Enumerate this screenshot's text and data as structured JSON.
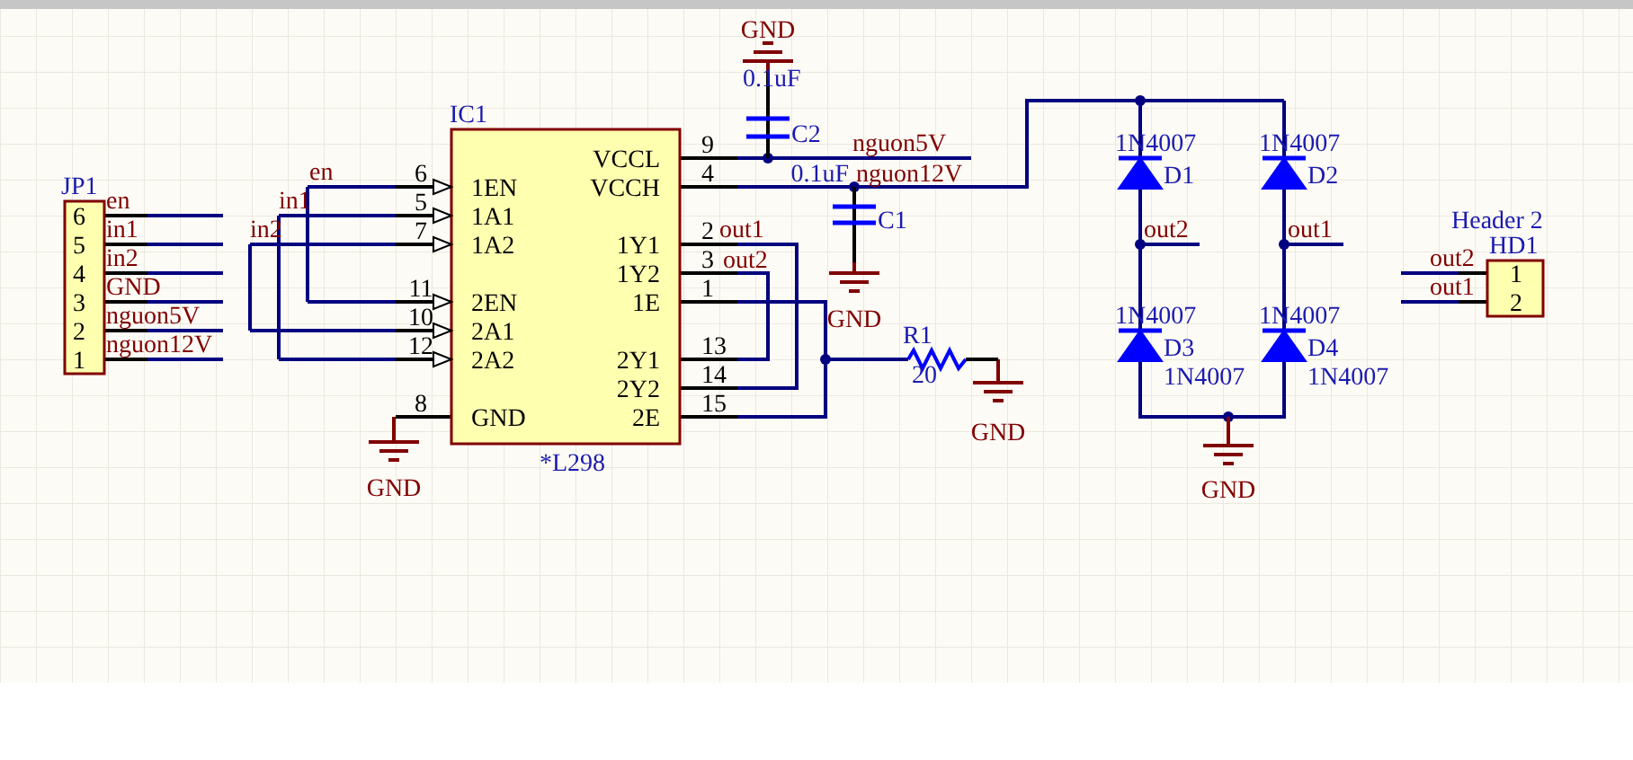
{
  "connectors": [
    {
      "designator": "JP1",
      "pins": [
        {
          "number": "6",
          "net": "en"
        },
        {
          "number": "5",
          "net": "in1"
        },
        {
          "number": "4",
          "net": "in2"
        },
        {
          "number": "3",
          "net": "GND"
        },
        {
          "number": "2",
          "net": "nguon5V"
        },
        {
          "number": "1",
          "net": "nguon12V"
        }
      ]
    },
    {
      "designator": "HD1",
      "comment": "Header 2",
      "pins": [
        {
          "number": "1",
          "net": "out2"
        },
        {
          "number": "2",
          "net": "out1"
        }
      ]
    }
  ],
  "ic": {
    "designator": "IC1",
    "comment": "*L298",
    "pins": [
      {
        "number": "6",
        "name": "1EN",
        "kind": "input"
      },
      {
        "number": "5",
        "name": "1A1",
        "kind": "input"
      },
      {
        "number": "7",
        "name": "1A2",
        "kind": "input"
      },
      {
        "number": "11",
        "name": "2EN",
        "kind": "input"
      },
      {
        "number": "10",
        "name": "2A1",
        "kind": "input"
      },
      {
        "number": "12",
        "name": "2A2",
        "kind": "input"
      },
      {
        "number": "8",
        "name": "GND",
        "kind": "passive"
      },
      {
        "number": "9",
        "name": "VCCL",
        "kind": "passive"
      },
      {
        "number": "4",
        "name": "VCCH",
        "kind": "passive"
      },
      {
        "number": "2",
        "name": "1Y1",
        "kind": "passive"
      },
      {
        "number": "3",
        "name": "1Y2",
        "kind": "passive"
      },
      {
        "number": "1",
        "name": "1E",
        "kind": "passive"
      },
      {
        "number": "13",
        "name": "2Y1",
        "kind": "passive"
      },
      {
        "number": "14",
        "name": "2Y2",
        "kind": "passive"
      },
      {
        "number": "15",
        "name": "2E",
        "kind": "passive"
      }
    ]
  },
  "net_labels": [
    "en",
    "in1",
    "in2",
    "nguon5V",
    "nguon12V",
    "out1",
    "out2",
    "out2",
    "out1"
  ],
  "capacitors": [
    {
      "designator": "C2",
      "value": "0.1uF"
    },
    {
      "designator": "C1",
      "value": "0.1uF"
    }
  ],
  "resistors": [
    {
      "designator": "R1",
      "value": "20"
    }
  ],
  "diodes": [
    {
      "designator": "D1",
      "comment": "1N4007"
    },
    {
      "designator": "D2",
      "comment": "1N4007"
    },
    {
      "designator": "D3",
      "comment": "1N4007",
      "value": "1N4007"
    },
    {
      "designator": "D4",
      "comment": "1N4007",
      "value": "1N4007"
    }
  ],
  "ground_ports": [
    "GND",
    "GND",
    "GND",
    "GND",
    "GND"
  ]
}
